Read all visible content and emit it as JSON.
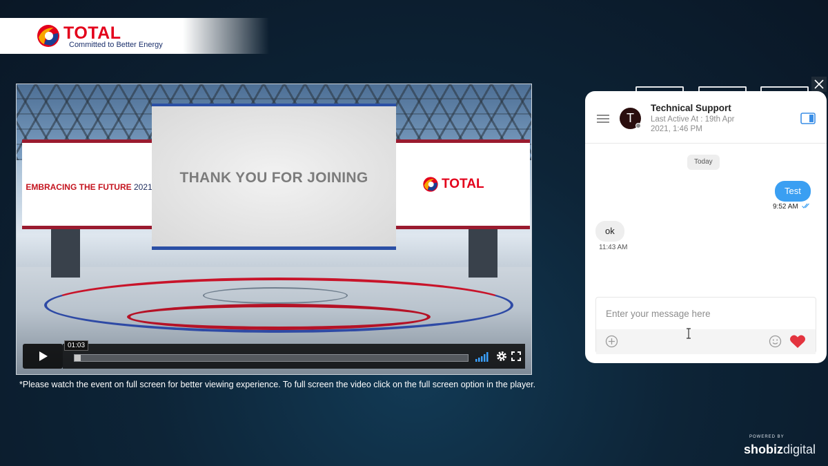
{
  "header": {
    "logo_word": "TOTAL",
    "logo_tagline": "Committed to Better Energy"
  },
  "video": {
    "left_screen_text": "EMBRACING THE FUTURE",
    "left_screen_year": "2021",
    "main_screen_text": "THANK YOU FOR JOINING",
    "right_screen_logo": "TOTAL",
    "time_tooltip": "01:03",
    "progress_fraction": 0.015
  },
  "notice": "*Please watch the event on full screen for better viewing experience. To full screen the video click on the full screen option in the player.",
  "chat": {
    "avatar_letter": "T",
    "contact_name": "Technical Support",
    "last_active": "Last Active At : 19th Apr 2021, 1:46 PM",
    "day_label": "Today",
    "messages": [
      {
        "direction": "out",
        "text": "Test",
        "time": "9:52 AM"
      },
      {
        "direction": "in",
        "text": "ok",
        "time": "11:43 AM"
      }
    ],
    "composer_placeholder": "Enter your message here"
  },
  "footer": {
    "powered_by": "POWERED BY",
    "brand_bold": "shobiz",
    "brand_thin": "digital"
  },
  "colors": {
    "brand_red": "#e3001b",
    "chat_bubble_out": "#3a9ff2",
    "heart": "#e3343f"
  }
}
